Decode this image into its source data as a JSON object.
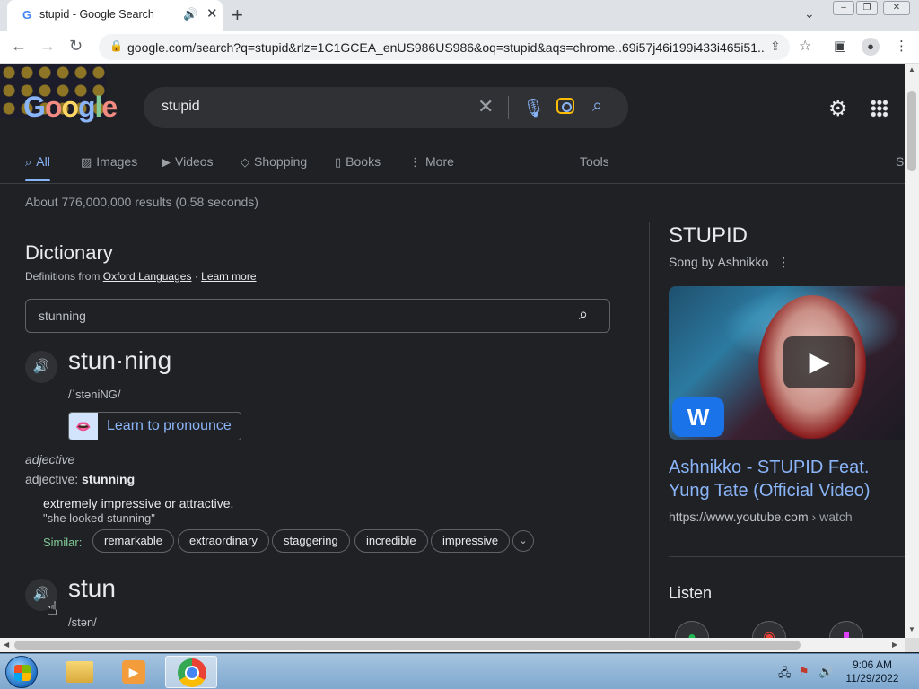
{
  "browser": {
    "tab_title": "stupid - Google Search",
    "favicon": "G",
    "url": "google.com/search?q=stupid&rlz=1C1GCEA_enUS986US986&oq=stupid&aqs=chrome..69i57j46i199i433i465i51..."
  },
  "google": {
    "logo": [
      "G",
      "o",
      "o",
      "g",
      "l",
      "e"
    ],
    "query": "stupid",
    "tabs": [
      {
        "icon": "search-icon",
        "label": "All"
      },
      {
        "icon": "images-icon",
        "label": "Images"
      },
      {
        "icon": "videos-icon",
        "label": "Videos"
      },
      {
        "icon": "shopping-tag-icon",
        "label": "Shopping"
      },
      {
        "icon": "book-icon",
        "label": "Books"
      },
      {
        "icon": "more-dots-icon",
        "label": "More"
      }
    ],
    "tools": "Tools",
    "safesearch_fragment": "S",
    "stats": "About 776,000,000 results (0.58 seconds)"
  },
  "dictionary": {
    "heading": "Dictionary",
    "source_prefix": "Definitions from",
    "source_link": "Oxford Languages",
    "learn_more": "Learn more",
    "search_value": "stunning",
    "entry1": {
      "word": "stun·ning",
      "phonetic": "/ˈstəniNG/",
      "learn_pronounce": "Learn to pronounce",
      "pos": "adjective",
      "pos_form_prefix": "adjective:",
      "pos_form_word": "stunning",
      "definition": "extremely impressive or attractive.",
      "example": "\"she looked stunning\"",
      "similar_label": "Similar:",
      "similar": [
        "remarkable",
        "extraordinary",
        "staggering",
        "incredible",
        "impressive"
      ]
    },
    "entry2": {
      "word": "stun",
      "phonetic": "/stən/"
    }
  },
  "knowledge_panel": {
    "title": "STUPID",
    "subtitle": "Song by Ashnikko",
    "video_badge": "W",
    "video_link": "Ashnikko - STUPID Feat. Yung Tate (Official Video)",
    "video_source_domain": "https://www.youtube.com",
    "video_source_path": " › watch",
    "listen": "Listen"
  },
  "taskbar": {
    "time": "9:06 AM",
    "date": "11/29/2022"
  },
  "colors": {
    "page_bg": "#202124",
    "link_blue": "#8ab4f8",
    "similar_green": "#81c995"
  }
}
